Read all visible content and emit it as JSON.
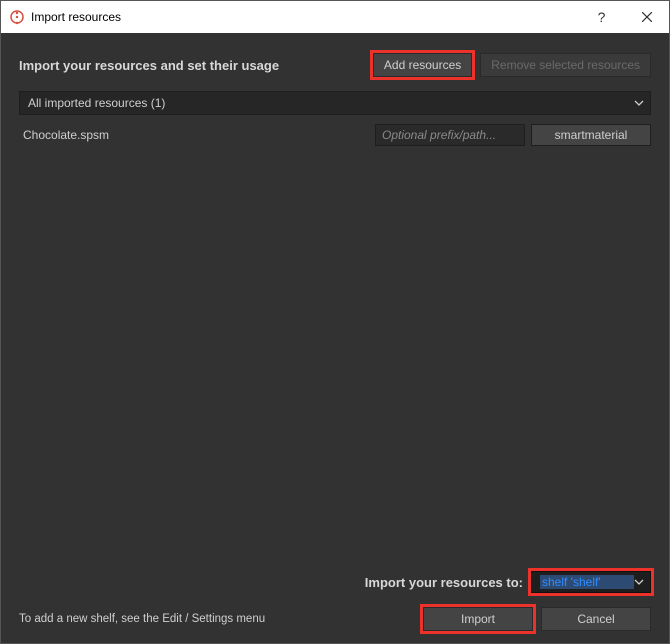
{
  "window": {
    "title": "Import resources"
  },
  "header": {
    "heading": "Import your resources and set their usage",
    "add_btn": "Add resources",
    "remove_btn": "Remove selected resources"
  },
  "resources_dropdown": {
    "label": "All imported resources (1)"
  },
  "rows": [
    {
      "name": "Chocolate.spsm",
      "prefix_placeholder": "Optional prefix/path...",
      "type": "smartmaterial"
    }
  ],
  "footer": {
    "import_to_label": "Import your resources to:",
    "shelf_value": "shelf 'shelf'",
    "hint": "To add a new shelf, see the Edit / Settings menu",
    "import_btn": "Import",
    "cancel_btn": "Cancel"
  }
}
